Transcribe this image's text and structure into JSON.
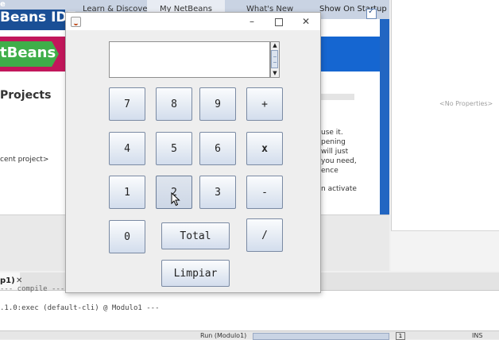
{
  "ide": {
    "title_small": "e",
    "title": "Beans IDE",
    "logo": "tBeans",
    "tabs": [
      "Learn & Discover",
      "My NetBeans",
      "What's New"
    ],
    "show_on_startup": "Show On Startup",
    "projects_heading": "Projects",
    "recent_project": "cent project>",
    "right_texts": [
      "use it.",
      "pening",
      " will just",
      " you need,",
      "ence",
      "n activate"
    ],
    "properties_empty": "<No Properties>",
    "output_tab": "p1)",
    "output_lines": [
      "--- compile --- dll-d",
      ".1.0:exec (default-cli) @ Modulo1 ---"
    ],
    "status_run": "Run (Modulo1)",
    "status_badge": "1",
    "status_ins": "INS"
  },
  "calculator": {
    "window_title": "",
    "display_value": "",
    "window_buttons": {
      "minimize": "–",
      "close": "✕"
    },
    "buttons": {
      "seven": "7",
      "eight": "8",
      "nine": "9",
      "plus": "+",
      "four": "4",
      "five": "5",
      "six": "6",
      "multiply": "x",
      "one": "1",
      "two": "2",
      "three": "3",
      "minus": "-",
      "zero": "0",
      "total": "Total",
      "divide": "/",
      "clear": "Limpiar"
    },
    "pressed_button": "two"
  }
}
